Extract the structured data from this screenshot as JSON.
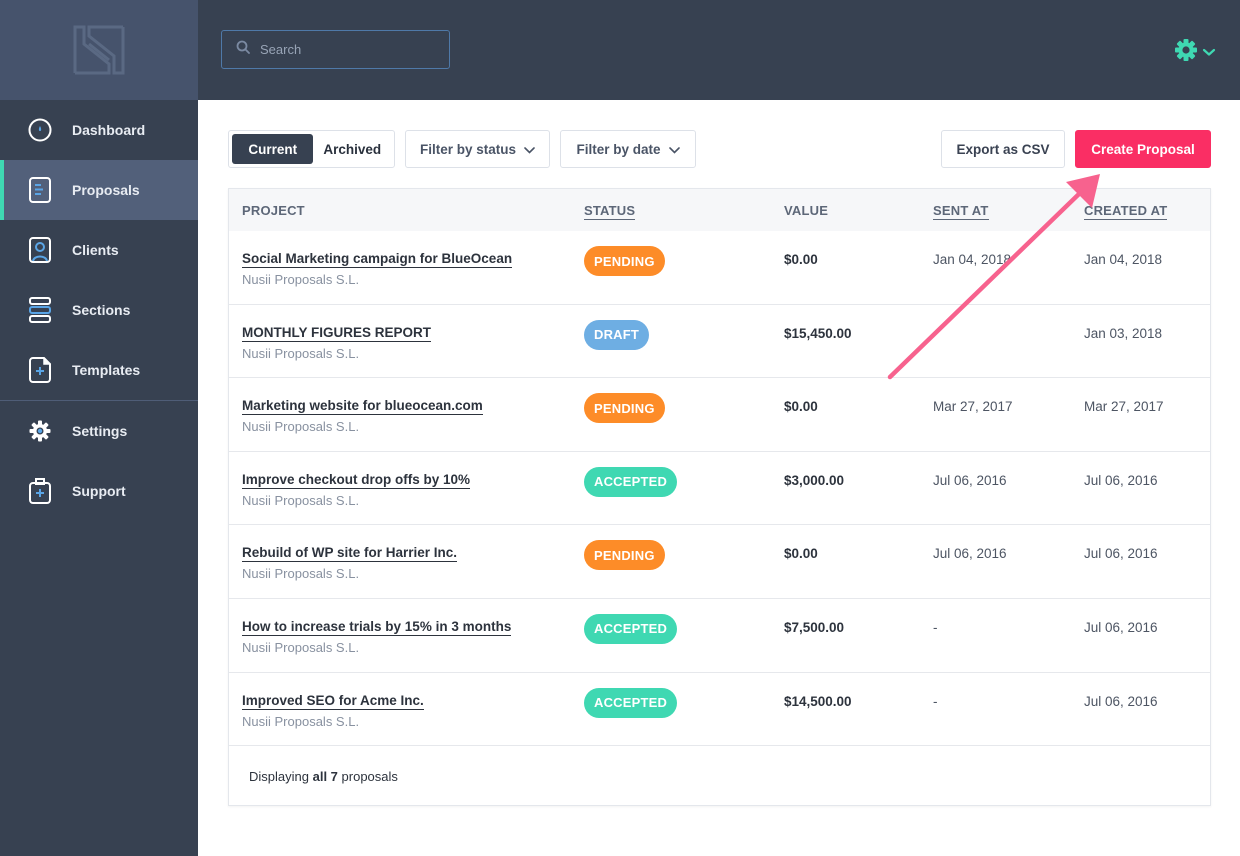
{
  "app": {
    "logo": "nusii-logo"
  },
  "header": {
    "search_placeholder": "Search",
    "search_value": "",
    "settings_icon": "gear-icon",
    "settings_caret": "chevron-down-icon",
    "accent": "#3fd8b2"
  },
  "sidebar": {
    "items": [
      {
        "label": "Dashboard",
        "icon": "dashboard-icon",
        "active": false
      },
      {
        "label": "Proposals",
        "icon": "document-icon",
        "active": true
      },
      {
        "label": "Clients",
        "icon": "client-icon",
        "active": false
      },
      {
        "label": "Sections",
        "icon": "sections-icon",
        "active": false
      },
      {
        "label": "Templates",
        "icon": "template-icon",
        "active": false
      },
      {
        "label": "Settings",
        "icon": "gear-icon",
        "active": false
      },
      {
        "label": "Support",
        "icon": "support-icon",
        "active": false
      }
    ]
  },
  "toolbar": {
    "tabs": [
      {
        "label": "Current",
        "selected": true
      },
      {
        "label": "Archived",
        "selected": false
      }
    ],
    "filter_status": "Filter by status",
    "filter_date": "Filter by date",
    "export_label": "Export as CSV",
    "create_label": "Create Proposal",
    "create_color": "#fa2e64"
  },
  "table": {
    "columns": [
      "PROJECT",
      "STATUS",
      "VALUE",
      "SENT AT",
      "CREATED AT"
    ],
    "rows": [
      {
        "title": "Social Marketing campaign for BlueOcean",
        "client": "Nusii Proposals S.L.",
        "status": "PENDING",
        "value": "$0.00",
        "sent_at": "Jan 04, 2018",
        "created_at": "Jan 04, 2018"
      },
      {
        "title": "MONTHLY FIGURES REPORT",
        "client": "Nusii Proposals S.L.",
        "status": "DRAFT",
        "value": "$15,450.00",
        "sent_at": "",
        "created_at": "Jan 03, 2018"
      },
      {
        "title": "Marketing website for blueocean.com",
        "client": "Nusii Proposals S.L.",
        "status": "PENDING",
        "value": "$0.00",
        "sent_at": "Mar 27, 2017",
        "created_at": "Mar 27, 2017"
      },
      {
        "title": "Improve checkout drop offs by 10%",
        "client": "Nusii Proposals S.L.",
        "status": "ACCEPTED",
        "value": "$3,000.00",
        "sent_at": "Jul 06, 2016",
        "created_at": "Jul 06, 2016"
      },
      {
        "title": "Rebuild of WP site for Harrier Inc.",
        "client": "Nusii Proposals S.L.",
        "status": "PENDING",
        "value": "$0.00",
        "sent_at": "Jul 06, 2016",
        "created_at": "Jul 06, 2016"
      },
      {
        "title": "How to increase trials by 15% in 3 months",
        "client": "Nusii Proposals S.L.",
        "status": "ACCEPTED",
        "value": "$7,500.00",
        "sent_at": "-",
        "created_at": "Jul 06, 2016"
      },
      {
        "title": "Improved SEO for Acme Inc.",
        "client": "Nusii Proposals S.L.",
        "status": "ACCEPTED",
        "value": "$14,500.00",
        "sent_at": "-",
        "created_at": "Jul 06, 2016"
      }
    ],
    "status_colors": {
      "PENDING": "#fd8c28",
      "DRAFT": "#6eaee3",
      "ACCEPTED": "#3fd8b2"
    },
    "footer": {
      "prefix": "Displaying",
      "bold": "all 7",
      "suffix": "proposals"
    }
  },
  "annotation": {
    "type": "arrow",
    "color": "#f7628e",
    "points_to": "create-proposal-button"
  }
}
